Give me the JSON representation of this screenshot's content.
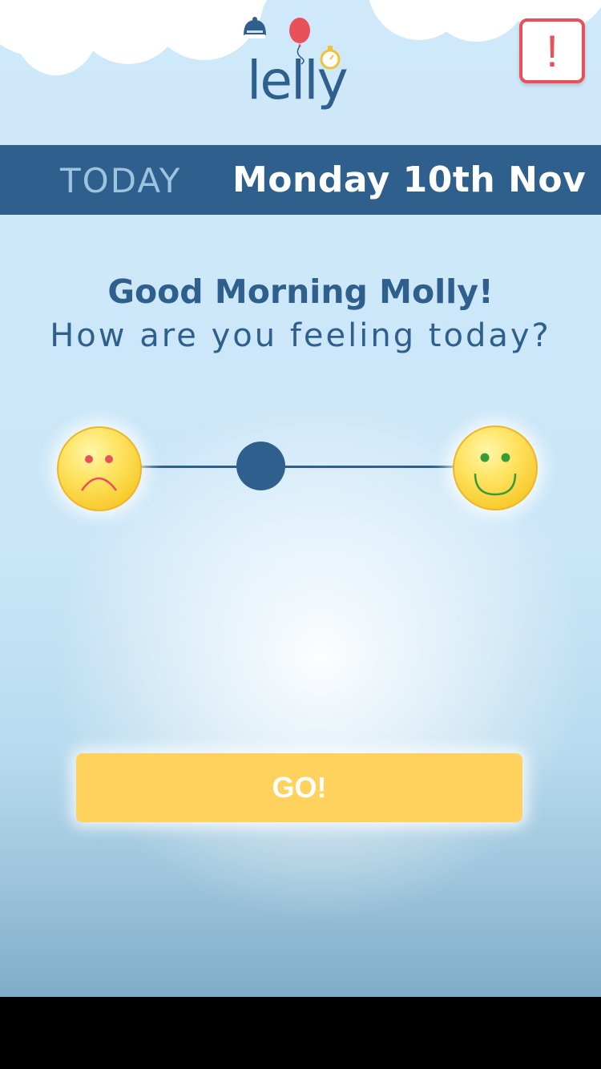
{
  "app": {
    "logo_text": "lelly"
  },
  "header": {
    "alert_label": "!"
  },
  "date_bar": {
    "today_label": "TODAY",
    "date": "Monday 10th Nov"
  },
  "greeting": {
    "title": "Good Morning Molly!",
    "question": "How are you feeling today?"
  },
  "mood_slider": {
    "min_icon": "sad-face-icon",
    "max_icon": "happy-face-icon",
    "value": 0.5
  },
  "go_button": {
    "label": "GO!"
  },
  "colors": {
    "primary": "#2f5f8d",
    "alert": "#e8505b",
    "button": "#ffd25e",
    "face": "#ffe566"
  }
}
